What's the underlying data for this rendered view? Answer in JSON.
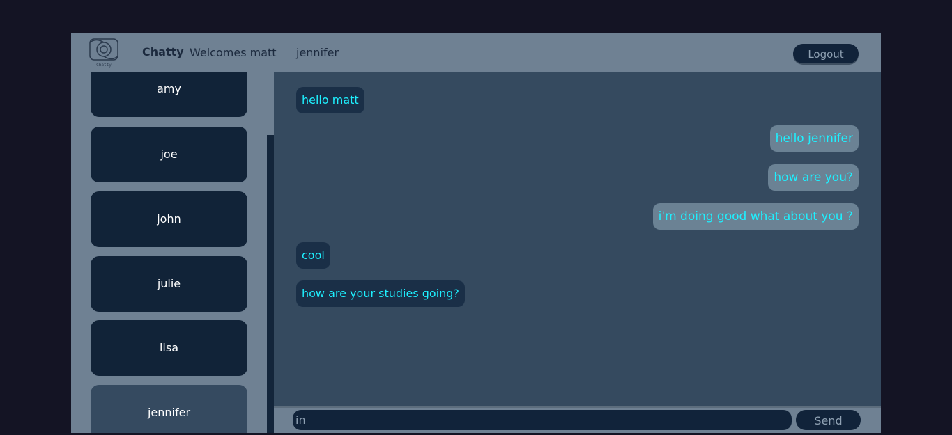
{
  "header": {
    "logo_text": "Chatty",
    "brand": "Chatty",
    "welcome": "Welcomes matt",
    "peer_name": "jennifer",
    "logout_label": "Logout"
  },
  "sidebar": {
    "contacts": [
      {
        "name": "amy"
      },
      {
        "name": "joe"
      },
      {
        "name": "john"
      },
      {
        "name": "julie"
      },
      {
        "name": "lisa"
      },
      {
        "name": "jennifer",
        "active": true
      }
    ]
  },
  "messages": [
    {
      "text": "hello matt",
      "direction": "incoming"
    },
    {
      "text": "hello jennifer",
      "direction": "outgoing"
    },
    {
      "text": "how are you?",
      "direction": "outgoing"
    },
    {
      "text": "i'm doing good what about you ?",
      "direction": "outgoing"
    },
    {
      "text": "cool",
      "direction": "incoming"
    },
    {
      "text": "how are your studies going?",
      "direction": "incoming"
    }
  ],
  "composer": {
    "input_value": "in",
    "send_label": "Send"
  },
  "colors": {
    "page_background": "#141424",
    "panel": "#6f8193",
    "chat_background": "#354a5f",
    "contact_card": "#112338",
    "active_contact": "#354a60",
    "message_text": "#1ef0ff",
    "incoming_bubble": "#1a2f47",
    "outgoing_bubble": "#6b8294"
  }
}
